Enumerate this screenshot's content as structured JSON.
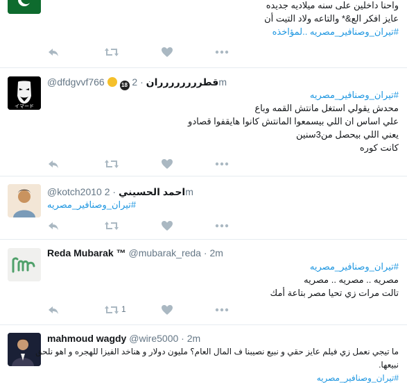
{
  "tweets": [
    {
      "fullname": "",
      "handle": "",
      "time": "",
      "lines": [
        "واحنا داخلين على سنه ميلاديه جديده",
        "عايز افكر الع&* والتاعه ولاد التيت أن",
        "#تيران_وصنافير_مصريه ..لمؤاخذه"
      ],
      "retweet_count": "",
      "avatar_icon": "flag-icon"
    },
    {
      "fullname": "قطرررررررران",
      "badge": "18",
      "handle": "@dfdgvvf766",
      "separator": "·",
      "time": "2m",
      "lines": [
        "#تيران_وصنافير_مصريه",
        "محدش يقولي استغل مانتش القمه وباع",
        "علي اساس ان اللي بيسمعوا المانتش كانوا هايقفوا قصادو",
        "يعني اللي بيحصل من3سنين",
        "كانت كوره"
      ],
      "retweet_count": "",
      "avatar_icon": "mask-icon",
      "avatar_text": "イマード"
    },
    {
      "fullname": "احمد الحسيني",
      "handle": "@kotch2010",
      "separator": "·",
      "time": "2m",
      "lines": [
        "#تيران_وصنافير_مصريه"
      ],
      "retweet_count": "",
      "avatar_icon": "person-photo-icon"
    },
    {
      "fullname": "Reda Mubarak ™",
      "handle": "@mubarak_reda",
      "separator": "·",
      "time": "2m",
      "lines": [
        "#تيران_وصنافير_مصريه",
        "مصريه .. مصريه .. مصريه",
        "تالت مرات زي تحيا مصر بتاعة أمك"
      ],
      "retweet_count": "1",
      "avatar_icon": "rm-logo-icon"
    },
    {
      "fullname": "mahmoud wagdy",
      "handle": "@wire5000",
      "separator": "·",
      "time": "2m",
      "lines": [
        "ما تيجي نعمل زي فيلم عايز حقي و نبيع نصيبنا ف المال العام؟ مليون دولار  و هناخد الفيزا للهجره و اهو نلحق",
        "نبيعها.",
        "#تيران_وصنافير_مصريه"
      ],
      "retweet_count": "",
      "avatar_icon": "person-photo-icon"
    }
  ],
  "colors": {
    "link": "#1b95e0",
    "icon": "#aab8c2",
    "meta": "#657786",
    "divider": "#e6ecf0"
  }
}
